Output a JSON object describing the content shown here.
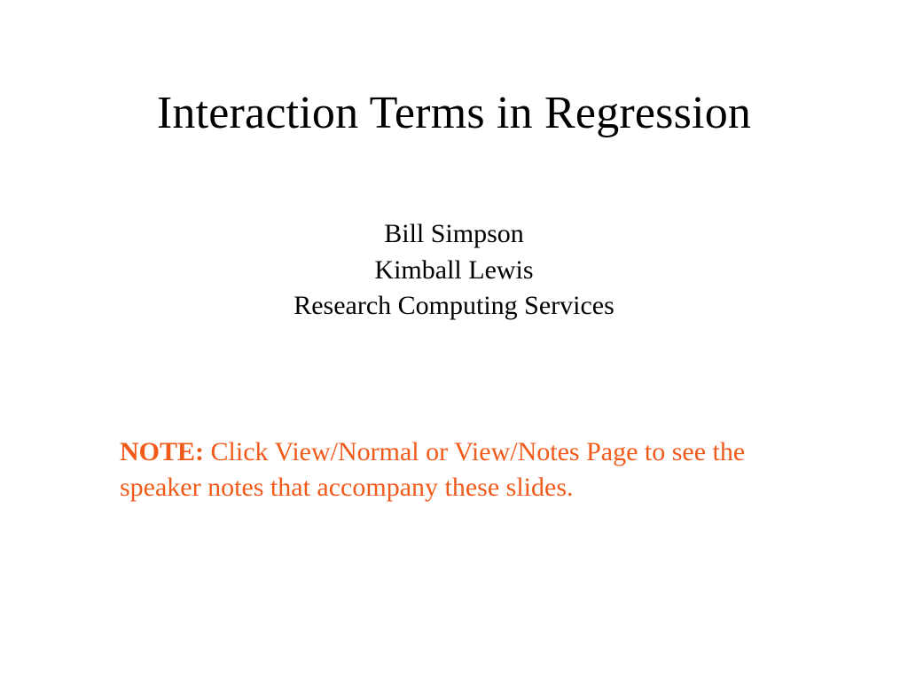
{
  "title": "Interaction Terms in Regression",
  "authors": {
    "line1": "Bill Simpson",
    "line2": "Kimball Lewis",
    "line3": "Research Computing Services"
  },
  "note": {
    "label": "NOTE:",
    "text": " Click View/Normal or View/Notes Page to see the speaker notes that accompany these slides."
  },
  "colors": {
    "accent": "#f25a1a"
  }
}
